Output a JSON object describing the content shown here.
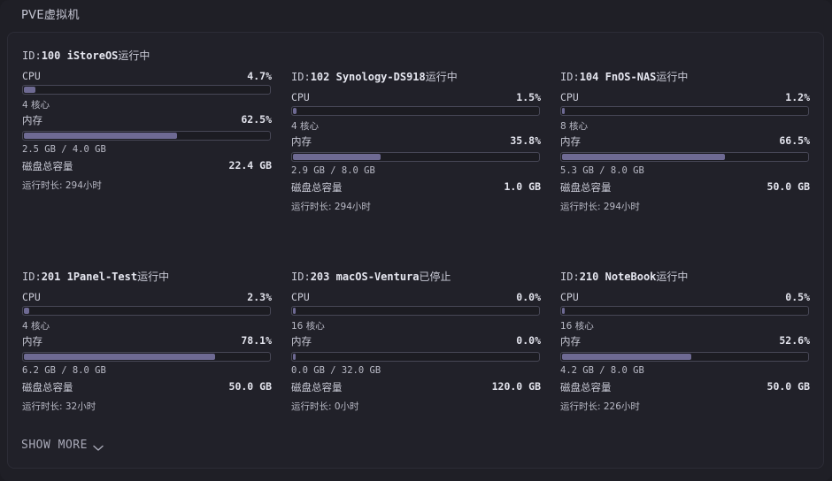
{
  "widget": {
    "title": "PVE虚拟机",
    "show_more_label": "SHOW MORE"
  },
  "labels": {
    "cpu": "CPU",
    "memory": "内存",
    "disk": "磁盘总容量",
    "id_prefix": "ID:"
  },
  "vms": [
    {
      "id": "100",
      "name": "iStoreOS",
      "status": "运行中",
      "cpu": "4.7%",
      "cpu_pct": 4.7,
      "cores": "4 核心",
      "mem": "62.5%",
      "mem_pct": 62.5,
      "mem_detail": "2.5 GB / 4.0 GB",
      "disk": "22.4 GB",
      "uptime": "运行时长: 294小时"
    },
    {
      "id": "102",
      "name": "Synology-DS918",
      "status": "运行中",
      "cpu": "1.5%",
      "cpu_pct": 1.5,
      "cores": "4 核心",
      "mem": "35.8%",
      "mem_pct": 35.8,
      "mem_detail": "2.9 GB / 8.0 GB",
      "disk": "1.0 GB",
      "uptime": "运行时长: 294小时"
    },
    {
      "id": "104",
      "name": "FnOS-NAS",
      "status": "运行中",
      "cpu": "1.2%",
      "cpu_pct": 1.2,
      "cores": "8 核心",
      "mem": "66.5%",
      "mem_pct": 66.5,
      "mem_detail": "5.3 GB / 8.0 GB",
      "disk": "50.0 GB",
      "uptime": "运行时长: 294小时"
    },
    {
      "id": "201",
      "name": "1Panel-Test",
      "status": "运行中",
      "cpu": "2.3%",
      "cpu_pct": 2.3,
      "cores": "4 核心",
      "mem": "78.1%",
      "mem_pct": 78.1,
      "mem_detail": "6.2 GB / 8.0 GB",
      "disk": "50.0 GB",
      "uptime": "运行时长: 32小时"
    },
    {
      "id": "203",
      "name": "macOS-Ventura",
      "status": "已停止",
      "cpu": "0.0%",
      "cpu_pct": 0.0,
      "cores": "16 核心",
      "mem": "0.0%",
      "mem_pct": 0.0,
      "mem_detail": "0.0 GB / 32.0 GB",
      "disk": "120.0 GB",
      "uptime": "运行时长: 0小时"
    },
    {
      "id": "210",
      "name": "NoteBook",
      "status": "运行中",
      "cpu": "0.5%",
      "cpu_pct": 0.5,
      "cores": "16 核心",
      "mem": "52.6%",
      "mem_pct": 52.6,
      "mem_detail": "4.2 GB / 8.0 GB",
      "disk": "50.0 GB",
      "uptime": "运行时长: 226小时"
    }
  ],
  "colors": {
    "background": "#1c1c22",
    "bar_fill": "#6e6a93",
    "bar_border": "#474756"
  },
  "icons": {
    "show_more": "chevron-down-icon"
  }
}
